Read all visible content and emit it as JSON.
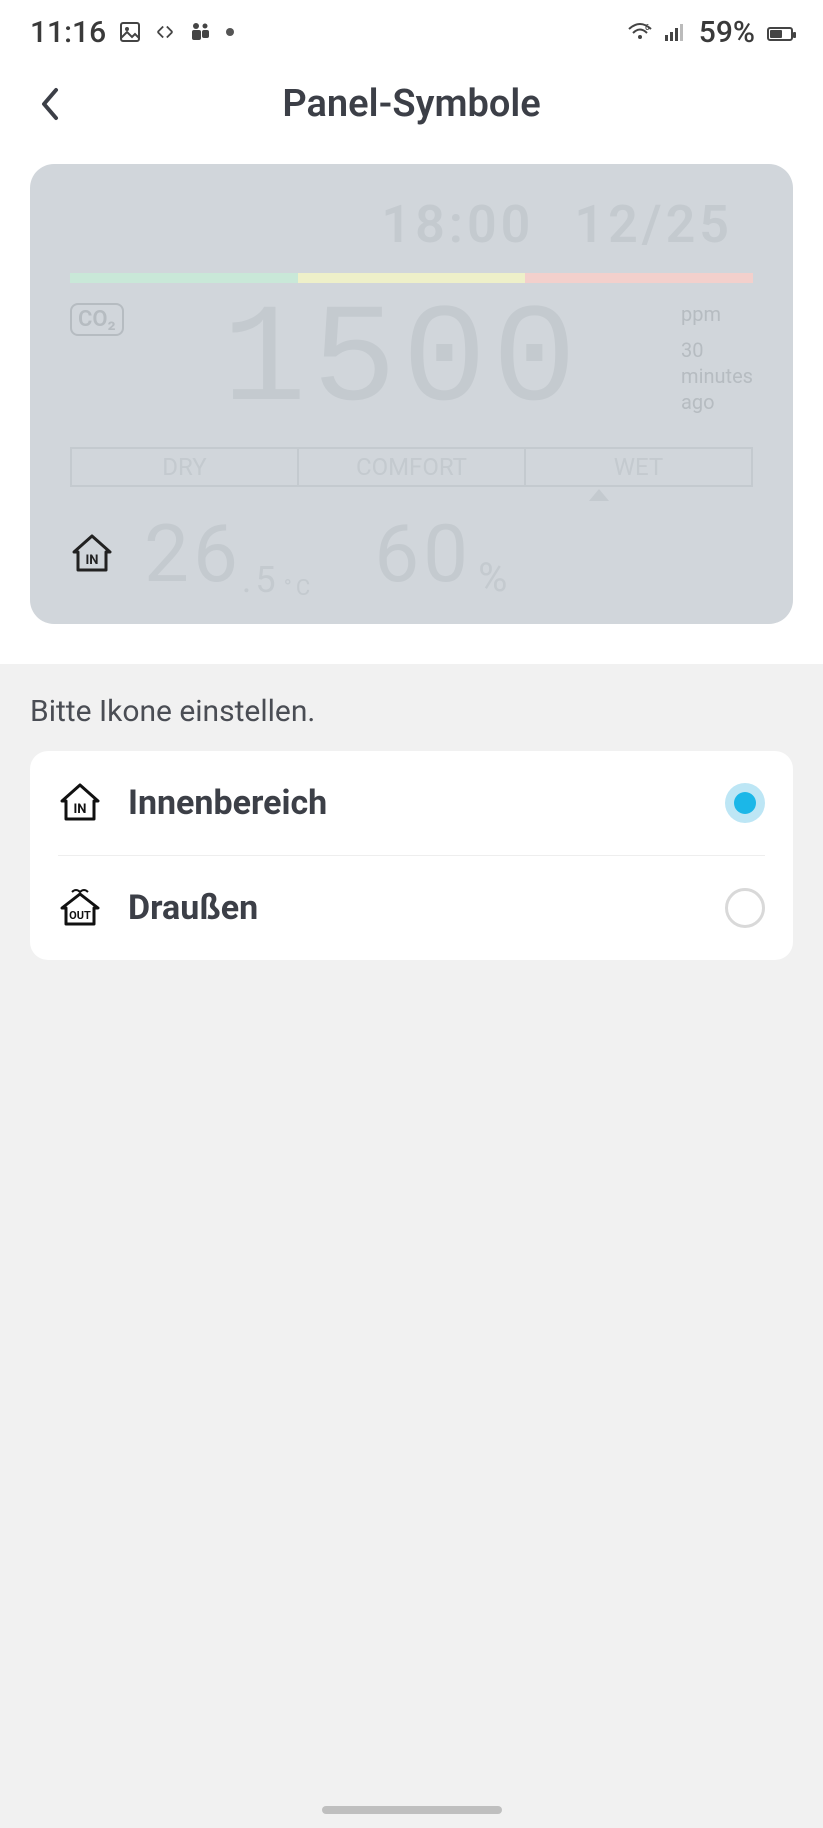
{
  "status": {
    "time": "11:16",
    "battery_pct": "59%"
  },
  "header": {
    "title": "Panel-Symbole"
  },
  "preview": {
    "time": "18:00",
    "date": "12/25",
    "co2_label": "CO₂",
    "co2_value": "1500",
    "co2_unit": "ppm",
    "co2_age_num": "30",
    "co2_age_unit": "minutes",
    "co2_age_suffix": "ago",
    "scale": {
      "dry": "DRY",
      "comfort": "COMFORT",
      "wet": "WET"
    },
    "temp_value": "26",
    "temp_decimal": ".5",
    "temp_unit": "°C",
    "humidity_value": "60",
    "humidity_unit": "%"
  },
  "instruction": "Bitte Ikone einstellen.",
  "options": {
    "indoor": {
      "label": "Innenbereich",
      "selected": true
    },
    "outdoor": {
      "label": "Draußen",
      "selected": false
    }
  }
}
